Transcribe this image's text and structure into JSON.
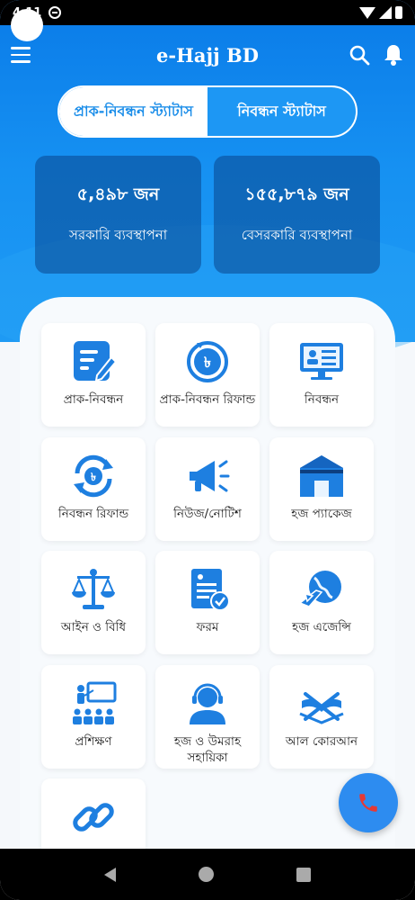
{
  "status_bar": {
    "time": "4:11"
  },
  "app_bar": {
    "title": "e-Hajj BD"
  },
  "toggle": {
    "options": [
      {
        "label": "প্রাক-নিবন্ধন স্ট্যাটাস",
        "active": true
      },
      {
        "label": "নিবন্ধন স্ট্যাটাস",
        "active": false
      }
    ]
  },
  "stats": [
    {
      "value": "৫,৪৯৮ জন",
      "label": "সরকারি ব্যবস্থাপনা"
    },
    {
      "value": "১৫৫,৮৭৯ জন",
      "label": "বেসরকারি ব্যবস্থাপনা"
    }
  ],
  "services": [
    {
      "label": "প্রাক-নিবন্ধন",
      "icon": "pre-registration-icon"
    },
    {
      "label": "প্রাক-নিবন্ধন রিফান্ড",
      "icon": "pre-registration-refund-icon"
    },
    {
      "label": "নিবন্ধন",
      "icon": "registration-icon"
    },
    {
      "label": "নিবন্ধন রিফান্ড",
      "icon": "registration-refund-icon"
    },
    {
      "label": "নিউজ/নোটিশ",
      "icon": "megaphone-icon"
    },
    {
      "label": "হজ প্যাকেজ",
      "icon": "kaaba-icon"
    },
    {
      "label": "আইন ও বিধি",
      "icon": "scales-icon"
    },
    {
      "label": "ফরম",
      "icon": "form-icon"
    },
    {
      "label": "হজ এজেন্সি",
      "icon": "plane-globe-icon"
    },
    {
      "label": "প্রশিক্ষণ",
      "icon": "training-icon"
    },
    {
      "label": "হজ ও উমরাহ সহায়িকা",
      "icon": "support-agent-icon"
    },
    {
      "label": "আল কোরআন",
      "icon": "quran-icon"
    },
    {
      "label": "",
      "icon": "link-icon"
    }
  ],
  "colors": {
    "primary": "#1a8de9",
    "header_dark": "#0a7be8",
    "fab": "#2d8cf0",
    "phone_icon": "#e53935"
  }
}
